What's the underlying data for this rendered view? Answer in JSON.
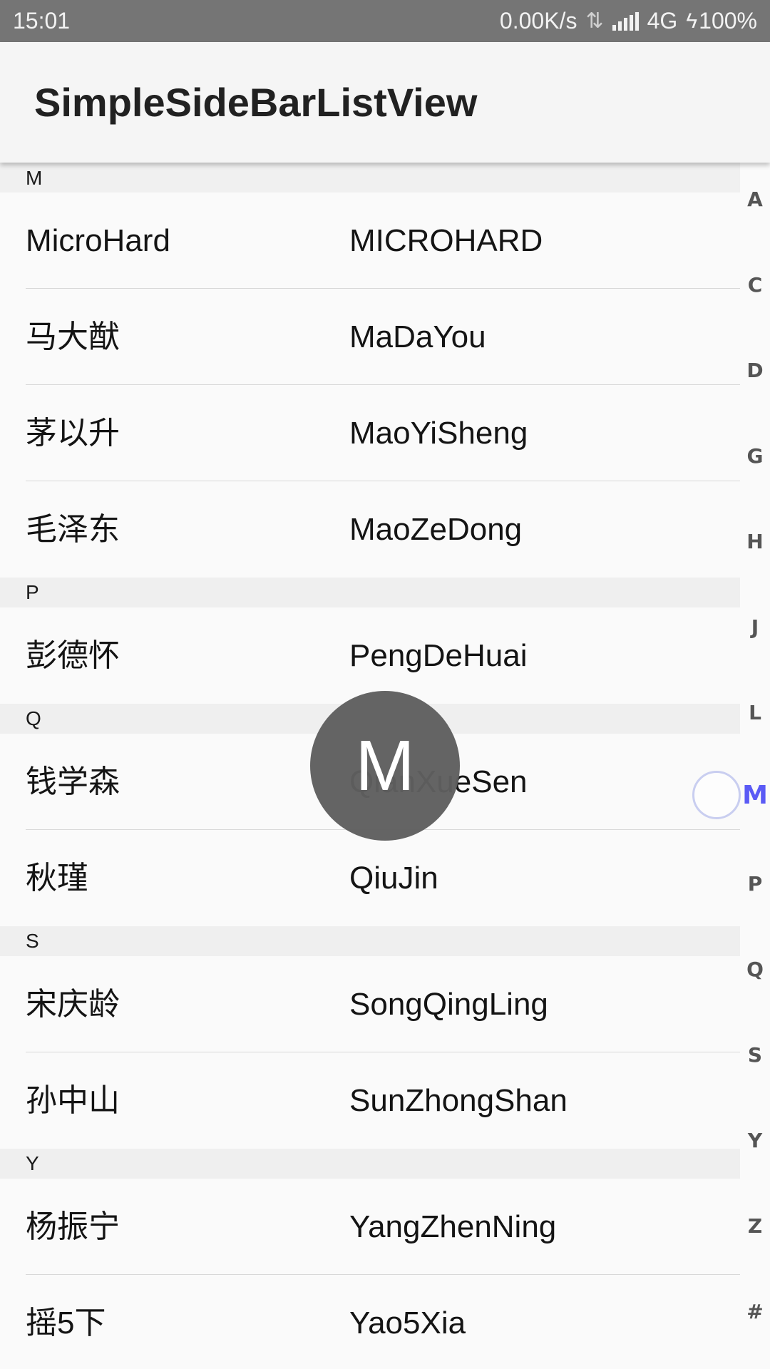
{
  "status_bar": {
    "time": "15:01",
    "speed": "0.00K/s",
    "network": "4G",
    "battery": "100%"
  },
  "app_bar": {
    "title": "SimpleSideBarListView"
  },
  "sections": [
    {
      "header": "M",
      "rows": [
        {
          "name": "MicroHard",
          "pinyin": "MICROHARD"
        },
        {
          "name": "马大猷",
          "pinyin": "MaDaYou"
        },
        {
          "name": "茅以升",
          "pinyin": "MaoYiSheng"
        },
        {
          "name": "毛泽东",
          "pinyin": "MaoZeDong"
        }
      ]
    },
    {
      "header": "P",
      "rows": [
        {
          "name": "彭德怀",
          "pinyin": "PengDeHuai"
        }
      ]
    },
    {
      "header": "Q",
      "rows": [
        {
          "name": "钱学森",
          "pinyin": "QianXueSen"
        },
        {
          "name": "秋瑾",
          "pinyin": "QiuJin"
        }
      ]
    },
    {
      "header": "S",
      "rows": [
        {
          "name": "宋庆龄",
          "pinyin": "SongQingLing"
        },
        {
          "name": "孙中山",
          "pinyin": "SunZhongShan"
        }
      ]
    },
    {
      "header": "Y",
      "rows": [
        {
          "name": "杨振宁",
          "pinyin": "YangZhenNing"
        },
        {
          "name": "摇5下",
          "pinyin": "Yao5Xia"
        }
      ]
    }
  ],
  "side_bar": {
    "letters": [
      "A",
      "C",
      "D",
      "G",
      "H",
      "J",
      "L",
      "M",
      "P",
      "Q",
      "S",
      "Y",
      "Z",
      "#"
    ],
    "active": "M",
    "active_color": "#5a5af5"
  },
  "index_bubble": {
    "letter": "M"
  }
}
